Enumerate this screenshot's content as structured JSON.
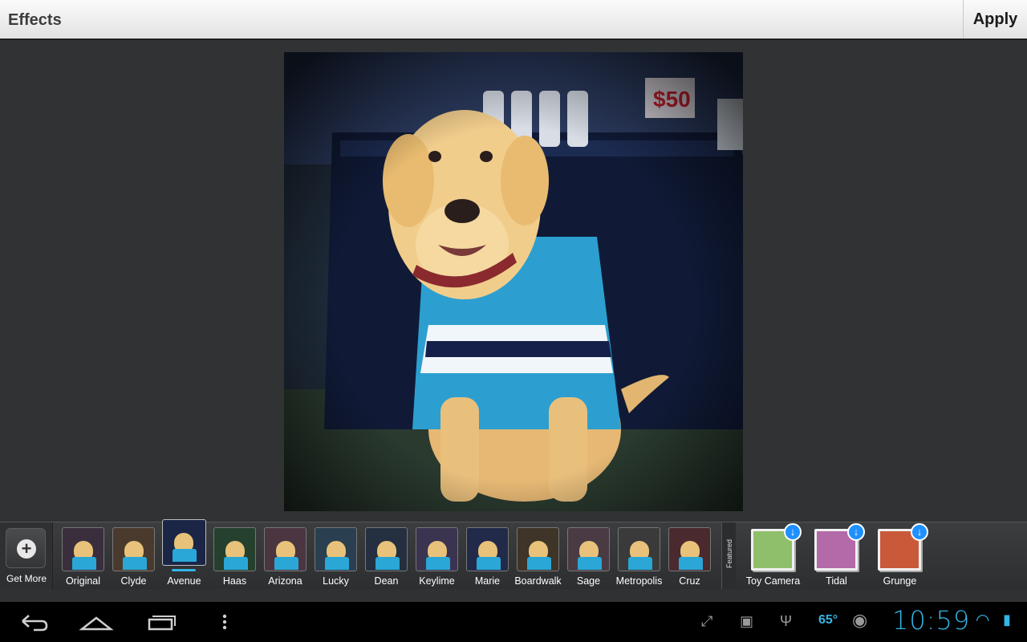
{
  "topbar": {
    "title": "Effects",
    "apply_label": "Apply"
  },
  "get_more": {
    "label": "Get More",
    "icon": "plus-icon"
  },
  "effects": [
    {
      "label": "Original",
      "tint": "#3a2e3c",
      "selected": false
    },
    {
      "label": "Clyde",
      "tint": "#4a3a2e",
      "selected": false
    },
    {
      "label": "Avenue",
      "tint": "#1b2647",
      "selected": true
    },
    {
      "label": "Haas",
      "tint": "#26402e",
      "selected": false
    },
    {
      "label": "Arizona",
      "tint": "#4a3540",
      "selected": false
    },
    {
      "label": "Lucky",
      "tint": "#2a3f4f",
      "selected": false
    },
    {
      "label": "Dean",
      "tint": "#24303f",
      "selected": false
    },
    {
      "label": "Keylime",
      "tint": "#3b3450",
      "selected": false
    },
    {
      "label": "Marie",
      "tint": "#222a4a",
      "selected": false
    },
    {
      "label": "Boardwalk",
      "tint": "#3f3428",
      "selected": false
    },
    {
      "label": "Sage",
      "tint": "#4a3a44",
      "selected": false
    },
    {
      "label": "Metropolis",
      "tint": "#3a3a3a",
      "selected": false
    },
    {
      "label": "Cruz",
      "tint": "#4a2a2e",
      "selected": false
    }
  ],
  "featured_label": "Featured",
  "featured_effects": [
    {
      "label": "Toy Camera",
      "tint": "#8fbf6a",
      "icon": "download-icon"
    },
    {
      "label": "Tidal",
      "tint": "#b26aa8",
      "icon": "download-icon"
    },
    {
      "label": "Grunge",
      "tint": "#c85a3a",
      "icon": "download-icon"
    }
  ],
  "status": {
    "time": "10:59",
    "temperature": "65°"
  },
  "colors": {
    "accent": "#33b5e5",
    "topbar": "#eeeeee",
    "canvas": "#303234"
  }
}
